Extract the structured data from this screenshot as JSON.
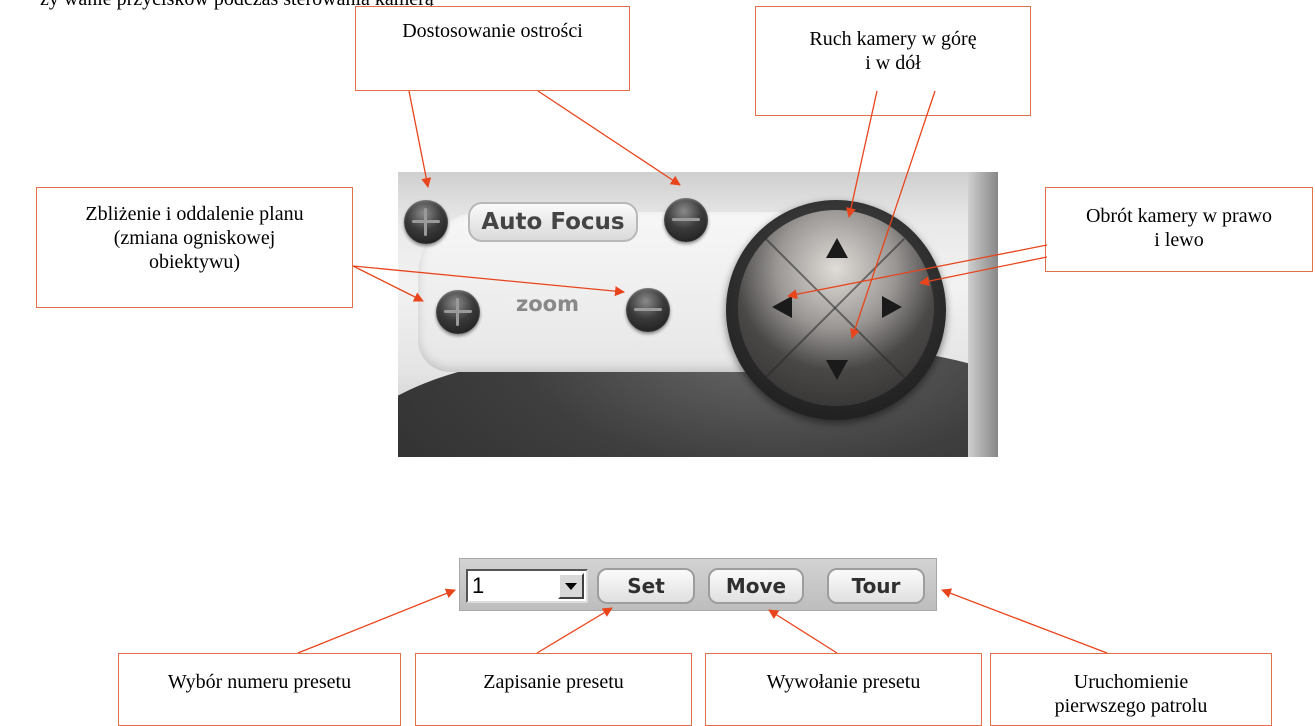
{
  "top_text_fragment": "ży    wanie przycisków podczas sterowania kamerą",
  "ptz_panel": {
    "auto_focus_label": "Auto Focus",
    "zoom_label": "zoom"
  },
  "preset_bar": {
    "preset_number": "1",
    "set_label": "Set",
    "move_label": "Move",
    "tour_label": "Tour"
  },
  "callouts": {
    "focus": "Dostosowanie ostrości",
    "tilt": "Ruch kamery w górę\ni w dół",
    "zoom": "Zbliżenie i oddalenie planu\n(zmiana ogniskowej\nobiektywu)",
    "pan": "Obrót kamery w prawo\ni lewo",
    "preset_select": "Wybór  numeru presetu",
    "preset_save": "Zapisanie presetu",
    "preset_call": "Wywołanie presetu",
    "tour": "Uruchomienie\npierwszego patrolu"
  },
  "colors": {
    "arrow": "#e8451c",
    "callout_border": "#e0704a"
  }
}
